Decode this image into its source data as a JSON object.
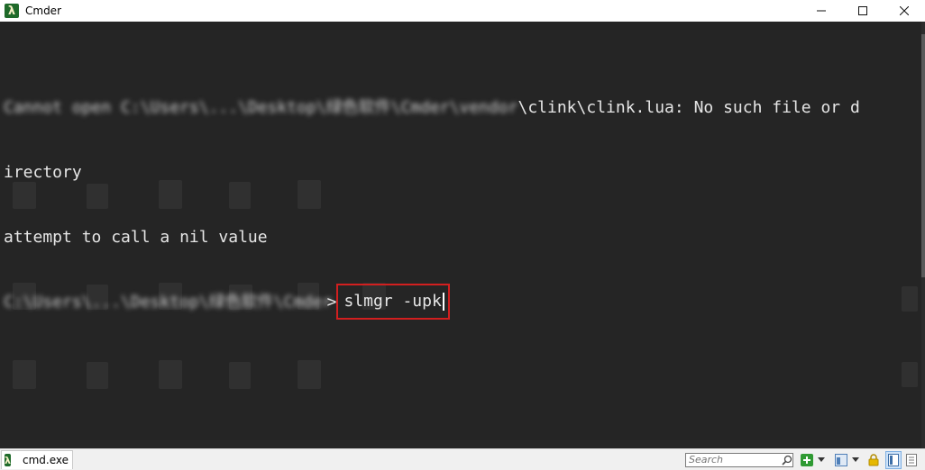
{
  "window": {
    "title": "Cmder",
    "app_icon_glyph": "λ"
  },
  "console": {
    "lines": [
      {
        "blurred_text": "Cannot open C:\\Users\\...\\Desktop\\绿色软件\\Cmder\\vendor",
        "plain_text": "\\clink\\clink.lua: No such file or d"
      },
      {
        "text": "irectory"
      },
      {
        "text": "attempt to call a nil value"
      }
    ],
    "prompt": {
      "blurred_path": "C:\\Users\\...\\Desktop\\绿色软件\\Cmder",
      "arrow": ">",
      "command": "slmgr -upk"
    },
    "highlight_color": "#d21f1f",
    "background_color": "#252525"
  },
  "statusbar": {
    "tab_label": "cmd.exe",
    "search_placeholder": "Search",
    "icons": [
      "search-icon",
      "add-console-icon",
      "dropdown-icon",
      "split-view-icon",
      "lock-icon",
      "layout-icon"
    ]
  }
}
